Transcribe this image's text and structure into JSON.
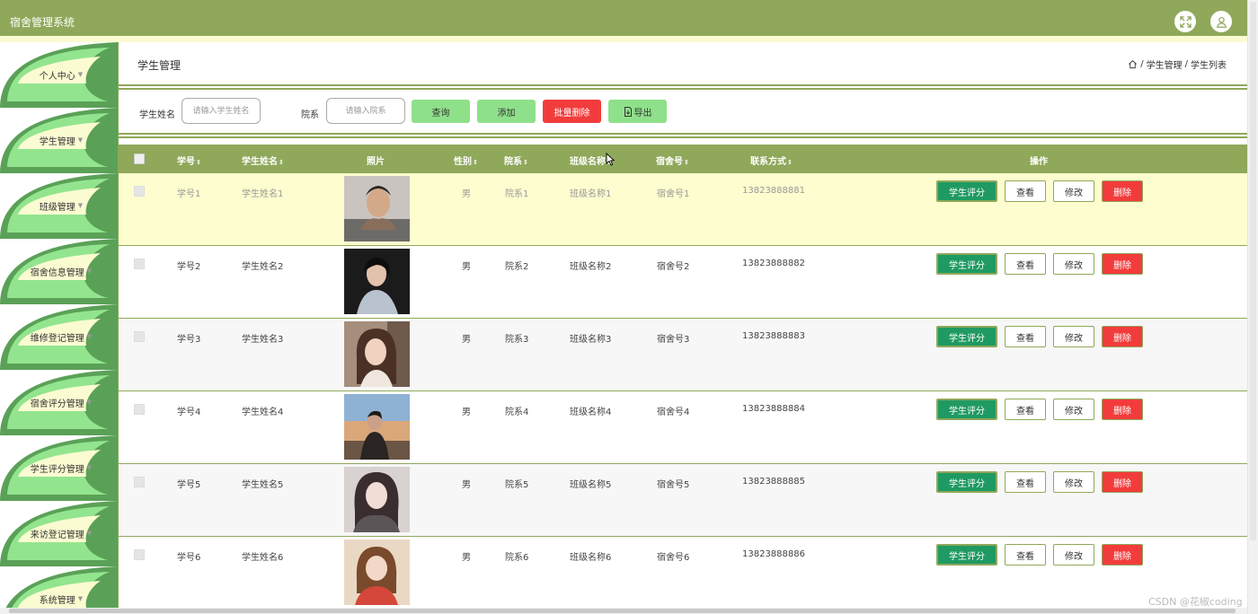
{
  "app": {
    "title": "宿舍管理系统"
  },
  "sidebar": {
    "items": [
      {
        "label": "个人中心"
      },
      {
        "label": "学生管理"
      },
      {
        "label": "班级管理"
      },
      {
        "label": "宿舍信息管理"
      },
      {
        "label": "维修登记管理"
      },
      {
        "label": "宿舍评分管理"
      },
      {
        "label": "学生评分管理"
      },
      {
        "label": "来访登记管理"
      },
      {
        "label": "系统管理"
      }
    ]
  },
  "header": {
    "title": "学生管理",
    "breadcrumb": {
      "level1": "学生管理",
      "level2": "学生列表",
      "sep": "/"
    }
  },
  "search": {
    "name_label": "学生姓名",
    "name_placeholder": "请输入学生姓名",
    "dept_label": "院系",
    "dept_placeholder": "请输入院系",
    "query_label": "查询",
    "add_label": "添加",
    "bulk_delete_label": "批量删除",
    "export_label": "导出"
  },
  "table": {
    "columns": {
      "id": "学号",
      "name": "学生姓名",
      "photo": "照片",
      "gender": "性别",
      "dept": "院系",
      "class": "班级名称",
      "dorm": "宿舍号",
      "phone": "联系方式",
      "actions": "操作"
    },
    "action_labels": {
      "score": "学生评分",
      "view": "查看",
      "edit": "修改",
      "delete": "删除"
    },
    "rows": [
      {
        "id": "学号1",
        "name": "学生姓名1",
        "gender": "男",
        "dept": "院系1",
        "class": "班级名称1",
        "dorm": "宿舍号1",
        "phone": "13823888881"
      },
      {
        "id": "学号2",
        "name": "学生姓名2",
        "gender": "男",
        "dept": "院系2",
        "class": "班级名称2",
        "dorm": "宿舍号2",
        "phone": "13823888882"
      },
      {
        "id": "学号3",
        "name": "学生姓名3",
        "gender": "男",
        "dept": "院系3",
        "class": "班级名称3",
        "dorm": "宿舍号3",
        "phone": "13823888883"
      },
      {
        "id": "学号4",
        "name": "学生姓名4",
        "gender": "男",
        "dept": "院系4",
        "class": "班级名称4",
        "dorm": "宿舍号4",
        "phone": "13823888884"
      },
      {
        "id": "学号5",
        "name": "学生姓名5",
        "gender": "男",
        "dept": "院系5",
        "class": "班级名称5",
        "dorm": "宿舍号5",
        "phone": "13823888885"
      },
      {
        "id": "学号6",
        "name": "学生姓名6",
        "gender": "男",
        "dept": "院系6",
        "class": "班级名称6",
        "dorm": "宿舍号6",
        "phone": "13823888886"
      }
    ]
  },
  "watermark": "CSDN @花椒coding",
  "colors": {
    "accent": "#8fa85a",
    "light_green": "#8fe08a",
    "danger": "#f23c3c",
    "highlight_row": "#fdfdcf",
    "score_button": "#1f9a62"
  }
}
